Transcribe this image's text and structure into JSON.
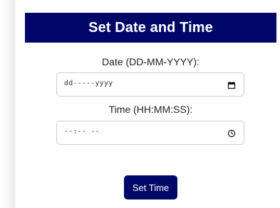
{
  "header": {
    "title": "Set Date and Time"
  },
  "date_field": {
    "label": "Date (DD-MM-YYYY):",
    "value": "dd-----yyyy",
    "icon": "calendar-icon"
  },
  "time_field": {
    "label": "Time (HH:MM:SS):",
    "value": "--:-- --",
    "icon": "clock-icon"
  },
  "submit_button": {
    "label": "Set Time"
  },
  "colors": {
    "primary": "#000766",
    "text": "#222222",
    "border": "#cfcfcf",
    "background": "#ffffff"
  }
}
